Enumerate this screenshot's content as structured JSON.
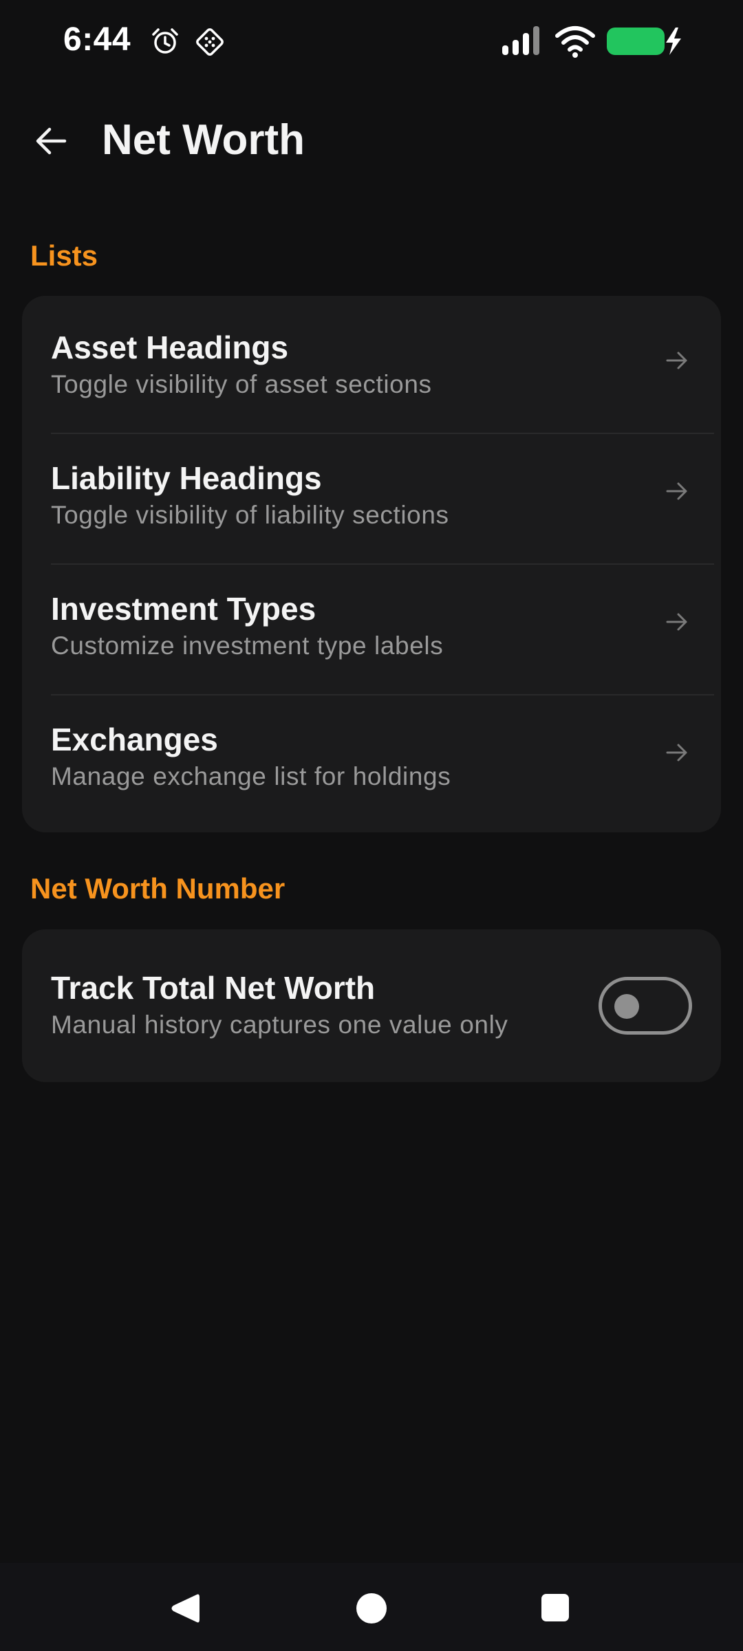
{
  "status_bar": {
    "time": "6:44",
    "icons": [
      "alarm-icon",
      "navigation-status-icon",
      "signal-icon",
      "wifi-icon",
      "battery-charging-icon"
    ],
    "battery_color": "#22c55e"
  },
  "app_bar": {
    "back_icon": "arrow-left-icon",
    "title": "Net Worth"
  },
  "sections": {
    "lists": {
      "header": "Lists",
      "items": [
        {
          "title": "Asset Headings",
          "subtitle": "Toggle visibility of asset sections"
        },
        {
          "title": "Liability Headings",
          "subtitle": "Toggle visibility of liability sections"
        },
        {
          "title": "Investment Types",
          "subtitle": "Customize investment type labels"
        },
        {
          "title": "Exchanges",
          "subtitle": "Manage exchange list for holdings"
        }
      ]
    },
    "net_worth_number": {
      "header": "Net Worth Number",
      "toggle": {
        "title": "Track Total Net Worth",
        "subtitle": "Manual history captures one value only",
        "checked": false
      }
    }
  },
  "colors": {
    "accent": "#f7931e",
    "background": "#101011",
    "card": "#1b1b1c"
  },
  "nav_bar": {
    "icons": [
      "back-triangle-icon",
      "home-circle-icon",
      "recents-square-icon"
    ]
  }
}
